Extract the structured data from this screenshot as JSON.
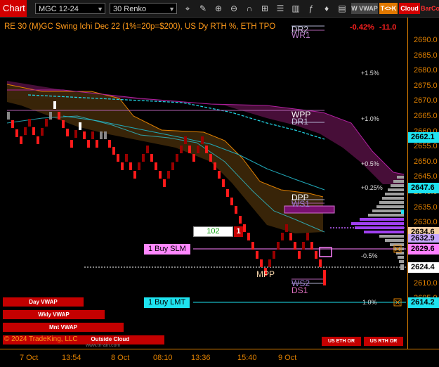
{
  "toolbar": {
    "chart_tab": "Chart",
    "instrument": "MGC 12-24",
    "bar_type": "30 Renko",
    "icons": [
      "crosshair-icon",
      "draw-icon",
      "zoom-in-icon",
      "zoom-out-icon",
      "magnet-icon",
      "objects-icon",
      "settings-icon",
      "chart-style-icon",
      "indicators-icon",
      "strategies-icon",
      "data-box-icon",
      "layers-icon",
      "alerts-icon"
    ],
    "btn_vwap": "W VWAP",
    "btn_tck": "T<>K",
    "btn_cloud": "Cloud",
    "btn_barco": "BarCo"
  },
  "chart": {
    "title": "RE 30 (M)GC Swing Ichi Dec 22 (1%=20p=$200), US Dy RTH %, ETH TPO",
    "pnl": "-0.42%",
    "pnl_right": "-11.0",
    "levels": {
      "dr2": "DR2",
      "wr1": "WR1",
      "wpp": "WPP",
      "dr1": "DR1",
      "dpp": "DPP",
      "ws1": "WS1",
      "mpp": "MPP",
      "ws2": "WS2",
      "ds1": "DS1"
    },
    "pct_labels": {
      "p15": "+1.5%",
      "p10": "+1.0%",
      "p05": "+0.5%",
      "p025": "+0.25%",
      "m05": "-0.5%",
      "m10": "1.0%"
    },
    "position_qty": "102",
    "position_count": "1",
    "order_slm": "1 Buy SLM",
    "order_lmt": "1 Buy LMT",
    "copyright": "© 2024 TradeKing, LLC",
    "copyright_sub": "www.tri-ain.com"
  },
  "buttons": {
    "day_vwap": "Day VWAP",
    "wkly_vwap": "Wkly VWAP",
    "mnt_vwap": "Mnt VWAP",
    "outside_cloud": "Outside Cloud",
    "us_eth_or": "US ETH OR",
    "us_rth_or": "US RTH OR"
  },
  "y_axis": {
    "ticks": [
      "2690.0",
      "2685.0",
      "2680.0",
      "2675.0",
      "2670.0",
      "2665.0",
      "2660.0",
      "2655.0",
      "2650.0",
      "2645.0",
      "2640.0",
      "2635.0",
      "2630.0",
      "2625.0",
      "2620.0",
      "2615.0",
      "2610.0",
      "2605.0"
    ],
    "tags": {
      "t1": {
        "label": "2662.1",
        "color": "#1ee3f0"
      },
      "t2": {
        "label": "2647.6",
        "color": "#1ee3f0"
      },
      "t3": {
        "label": "2634.6",
        "color": "#f5d3a8"
      },
      "t4": {
        "label": "2632.9",
        "color": "#c8a8ff"
      },
      "t5": {
        "label": "2629.6",
        "color": "#ff80ff"
      },
      "t6": {
        "label": "2624.4",
        "color": "#ffffff"
      },
      "t7": {
        "label": "2614.2",
        "color": "#1ee3f0"
      }
    }
  },
  "x_axis": {
    "ticks": [
      "7 Oct",
      "13:54",
      "8 Oct",
      "08:10",
      "13:36",
      "15:40",
      "9 Oct"
    ]
  },
  "colors": {
    "accent": "#e08000",
    "up": "#9a0000",
    "down": "#ff1a1a",
    "cloud": "#4b0f3b",
    "orange_cloud": "#3b2608"
  }
}
